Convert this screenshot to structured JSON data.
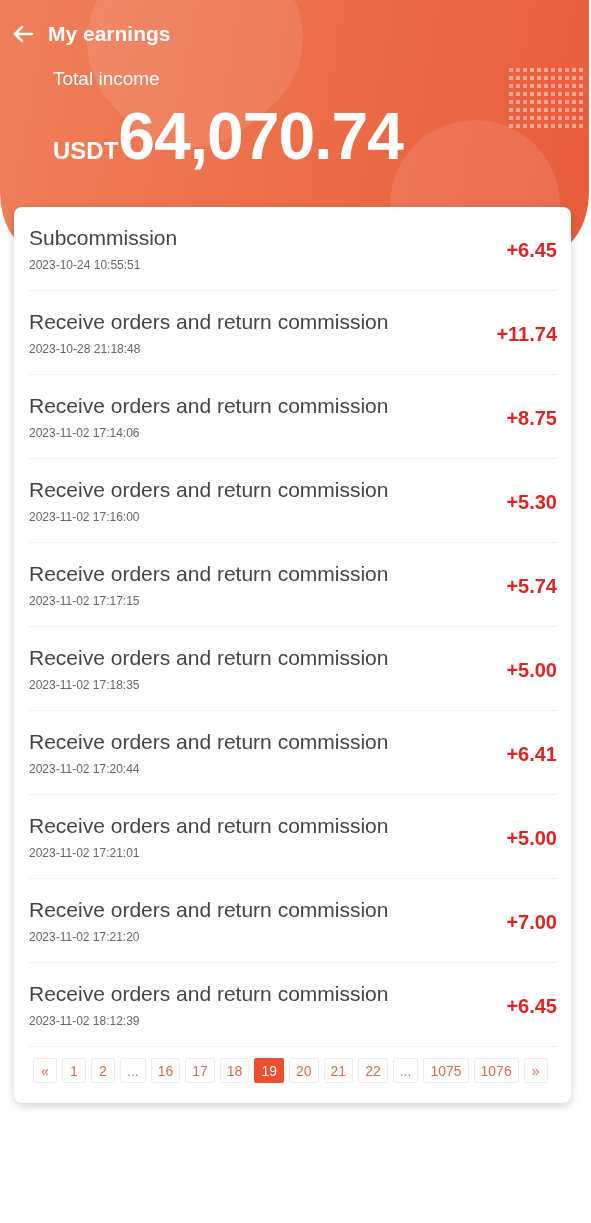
{
  "header": {
    "title": "My earnings",
    "total_label": "Total income",
    "currency": "USDT",
    "total": "64,070.74"
  },
  "records": [
    {
      "title": "Subcommission",
      "time": "2023-10-24 10:55:51",
      "amount": "+6.45"
    },
    {
      "title": "Receive orders and return commission",
      "time": "2023-10-28 21:18:48",
      "amount": "+11.74"
    },
    {
      "title": "Receive orders and return commission",
      "time": "2023-11-02 17:14:06",
      "amount": "+8.75"
    },
    {
      "title": "Receive orders and return commission",
      "time": "2023-11-02 17:16:00",
      "amount": "+5.30"
    },
    {
      "title": "Receive orders and return commission",
      "time": "2023-11-02 17:17:15",
      "amount": "+5.74"
    },
    {
      "title": "Receive orders and return commission",
      "time": "2023-11-02 17:18:35",
      "amount": "+5.00"
    },
    {
      "title": "Receive orders and return commission",
      "time": "2023-11-02 17:20:44",
      "amount": "+6.41"
    },
    {
      "title": "Receive orders and return commission",
      "time": "2023-11-02 17:21:01",
      "amount": "+5.00"
    },
    {
      "title": "Receive orders and return commission",
      "time": "2023-11-02 17:21:20",
      "amount": "+7.00"
    },
    {
      "title": "Receive orders and return commission",
      "time": "2023-11-02 18:12:39",
      "amount": "+6.45"
    }
  ],
  "pagination": [
    {
      "label": "«",
      "kind": "nav",
      "selected": false
    },
    {
      "label": "1",
      "kind": "page",
      "selected": false
    },
    {
      "label": "2",
      "kind": "page",
      "selected": false
    },
    {
      "label": "...",
      "kind": "ellipsis",
      "selected": false
    },
    {
      "label": "16",
      "kind": "page",
      "selected": false
    },
    {
      "label": "17",
      "kind": "page",
      "selected": false
    },
    {
      "label": "18",
      "kind": "page",
      "selected": false
    },
    {
      "label": "19",
      "kind": "page",
      "selected": true
    },
    {
      "label": "20",
      "kind": "page",
      "selected": false
    },
    {
      "label": "21",
      "kind": "page",
      "selected": false
    },
    {
      "label": "22",
      "kind": "page",
      "selected": false
    },
    {
      "label": "...",
      "kind": "ellipsis",
      "selected": false
    },
    {
      "label": "1075",
      "kind": "page",
      "selected": false
    },
    {
      "label": "1076",
      "kind": "page",
      "selected": false
    },
    {
      "label": "»",
      "kind": "nav",
      "selected": false
    }
  ]
}
